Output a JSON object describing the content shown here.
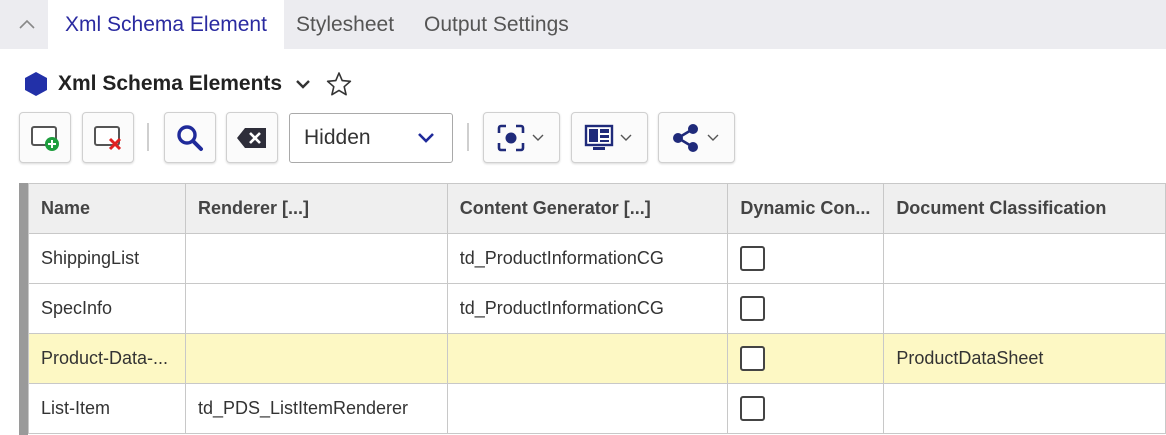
{
  "tabs": [
    {
      "label": "Xml Schema Element",
      "active": true
    },
    {
      "label": "Stylesheet",
      "active": false
    },
    {
      "label": "Output Settings",
      "active": false
    }
  ],
  "header": {
    "title": "Xml Schema Elements"
  },
  "toolbar": {
    "visibility_select": {
      "value": "Hidden"
    },
    "icons": [
      "add-icon",
      "delete-icon",
      "search-icon",
      "clear-filter-icon",
      "focus-icon",
      "layout-icon",
      "share-icon"
    ]
  },
  "table": {
    "columns": [
      "Name",
      "Renderer [...]",
      "Content Generator [...]",
      "Dynamic Con...",
      "Document Classification"
    ],
    "rows": [
      {
        "name": "ShippingList",
        "renderer": "",
        "content_generator": "td_ProductInformationCG",
        "dynamic": false,
        "classification": "",
        "selected": false
      },
      {
        "name": "SpecInfo",
        "renderer": "",
        "content_generator": "td_ProductInformationCG",
        "dynamic": false,
        "classification": "",
        "selected": false
      },
      {
        "name": "Product-Data-...",
        "renderer": "",
        "content_generator": "",
        "dynamic": false,
        "classification": "ProductDataSheet",
        "selected": true
      },
      {
        "name": "List-Item",
        "renderer": "td_PDS_ListItemRenderer",
        "content_generator": "",
        "dynamic": false,
        "classification": "",
        "selected": false
      }
    ]
  },
  "colors": {
    "accent": "#2a2aa0",
    "selected_row": "#fdf8c4",
    "tabbar": "#ececf0",
    "delete_red": "#e02020",
    "add_green": "#1e9e3e"
  }
}
